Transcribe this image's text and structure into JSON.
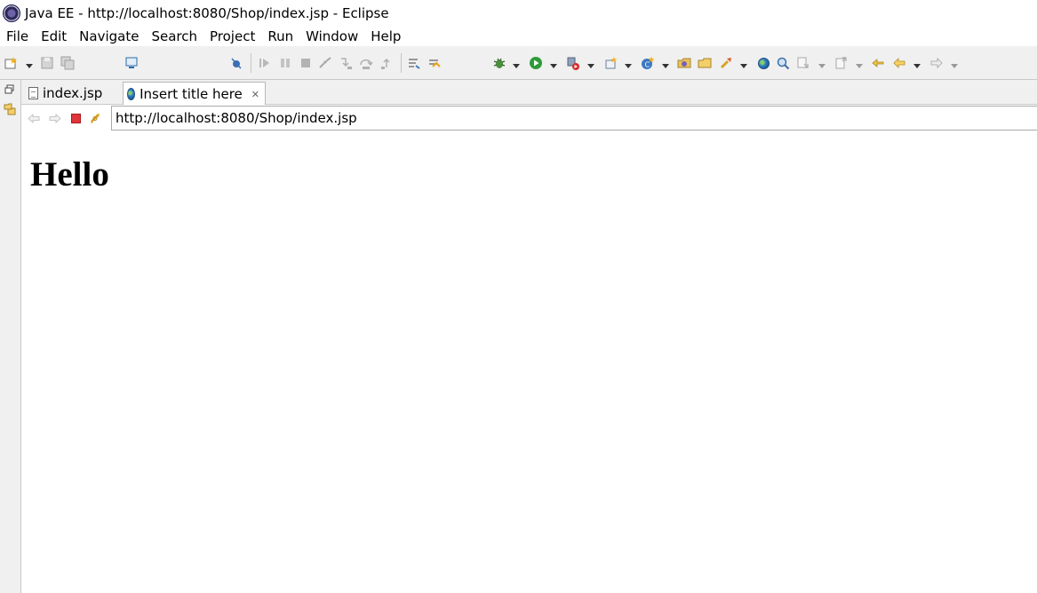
{
  "window": {
    "title": "Java EE - http://localhost:8080/Shop/index.jsp - Eclipse"
  },
  "menu": [
    "File",
    "Edit",
    "Navigate",
    "Search",
    "Project",
    "Run",
    "Window",
    "Help"
  ],
  "tabs": [
    {
      "label": "index.jsp",
      "icon": "jsp-file-icon",
      "active": false
    },
    {
      "label": "Insert title here",
      "icon": "globe-icon",
      "active": true
    }
  ],
  "browser": {
    "url": "http://localhost:8080/Shop/index.jsp"
  },
  "page": {
    "heading": "Hello"
  },
  "colors": {
    "toolbar_bg": "#f0f0f0",
    "stop_red": "#e0353b",
    "run_green": "#2e9b3a"
  }
}
